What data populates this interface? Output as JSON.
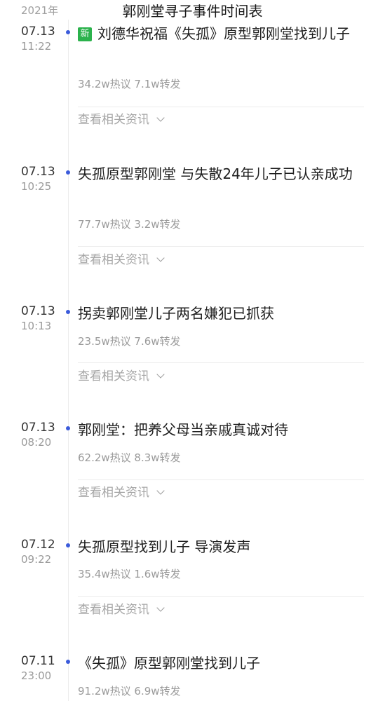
{
  "header": {
    "year": "2021年",
    "title": "郭刚堂寻子事件时间表"
  },
  "related_label": "查看相关资讯",
  "events": [
    {
      "date": "07.13",
      "time": "11:22",
      "is_new": true,
      "new_label": "新",
      "headline": "刘德华祝福《失孤》原型郭刚堂找到儿子",
      "stats": "34.2w热议 7.1w转发"
    },
    {
      "date": "07.13",
      "time": "10:25",
      "is_new": false,
      "headline": "失孤原型郭刚堂 与失散24年儿子已认亲成功",
      "stats": "77.7w热议 3.2w转发"
    },
    {
      "date": "07.13",
      "time": "10:13",
      "is_new": false,
      "headline": "拐卖郭刚堂儿子两名嫌犯已抓获",
      "stats": "23.5w热议 7.6w转发"
    },
    {
      "date": "07.13",
      "time": "08:20",
      "is_new": false,
      "headline": "郭刚堂：把养父母当亲戚真诚对待",
      "stats": "62.2w热议 8.3w转发"
    },
    {
      "date": "07.12",
      "time": "09:22",
      "is_new": false,
      "headline": "失孤原型找到儿子 导演发声",
      "stats": "35.4w热议 1.6w转发"
    },
    {
      "date": "07.11",
      "time": "23:00",
      "is_new": false,
      "headline": "《失孤》原型郭刚堂找到儿子",
      "stats": "91.2w热议 6.9w转发"
    }
  ]
}
